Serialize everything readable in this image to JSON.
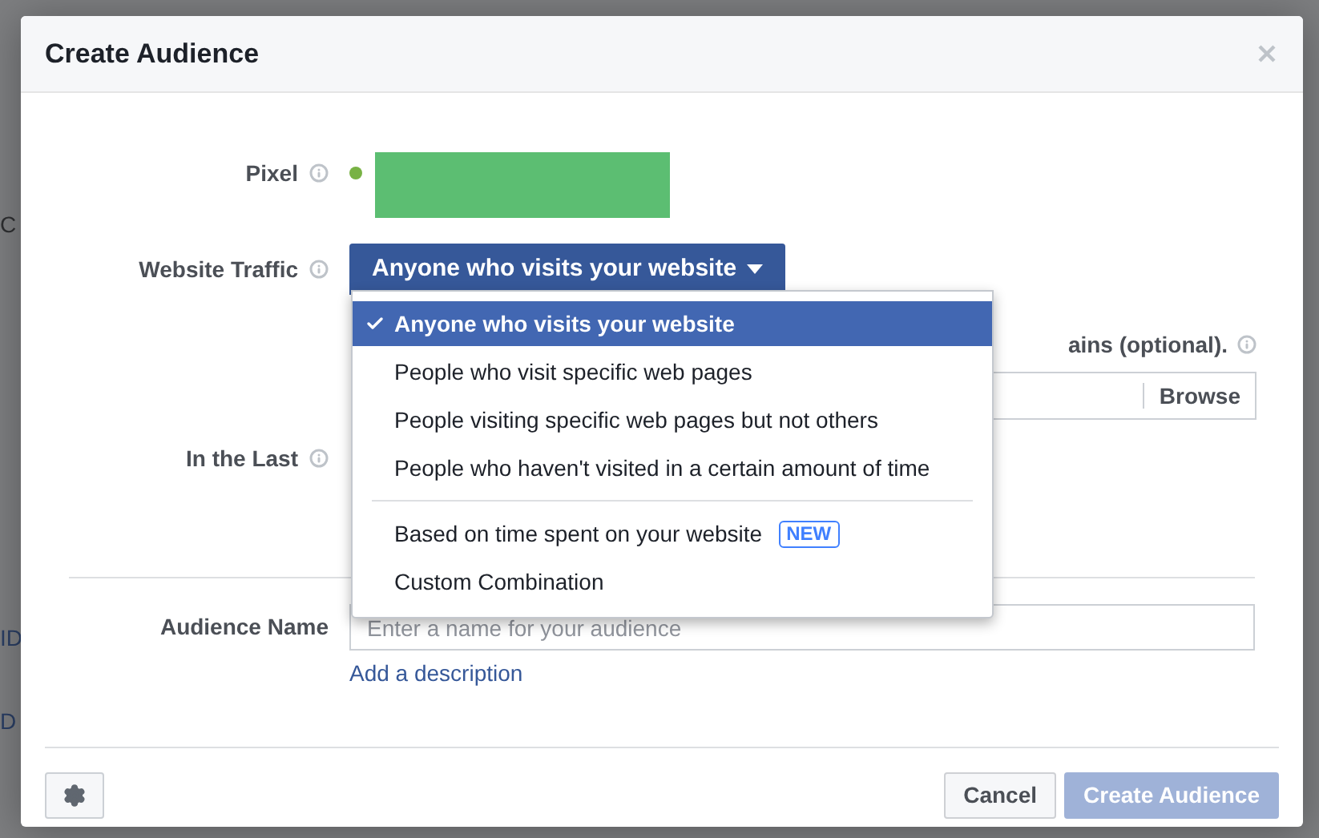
{
  "background": {
    "fragments": [
      {
        "text": "C",
        "kind": "left"
      },
      {
        "text": "ID",
        "kind": "link"
      },
      {
        "text": "D",
        "kind": "link"
      }
    ]
  },
  "dialog": {
    "title": "Create Audience",
    "fields": [
      {
        "kind": "pixel",
        "label": "Pixel"
      },
      {
        "kind": "select",
        "label": "Website Traffic",
        "value": "Anyone who visits your website"
      },
      {
        "kind": "domains",
        "text": "ains (optional).",
        "button": "Browse"
      },
      {
        "kind": "last",
        "label": "In the Last"
      }
    ],
    "audience_name": {
      "label": "Audience Name",
      "placeholder": "Enter a name for your audience",
      "link": "Add a description"
    },
    "menu": [
      {
        "label": "Anyone who visits your website",
        "selected": true
      },
      {
        "label": "People who visit specific web pages",
        "selected": false
      },
      {
        "label": "People visiting specific web pages but not others",
        "selected": false
      },
      {
        "label": "People who haven't visited in a certain amount of time",
        "selected": false
      },
      {
        "label": "Based on time spent on your website",
        "selected": false,
        "separator_before": true,
        "badge": "NEW"
      },
      {
        "label": "Custom Combination",
        "selected": false
      }
    ],
    "buttons": [
      {
        "label": "Cancel",
        "disabled": false
      },
      {
        "label": "Create Audience",
        "disabled": true
      }
    ]
  }
}
